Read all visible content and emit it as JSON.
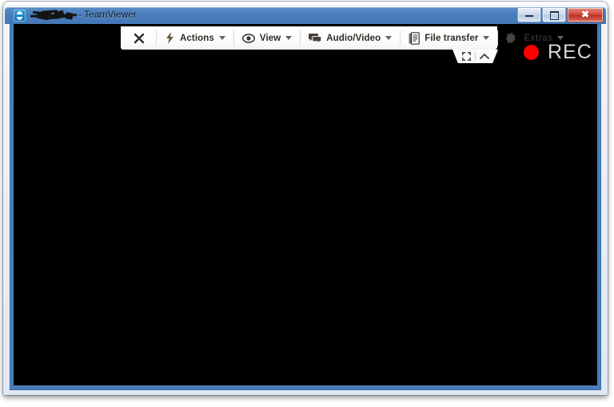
{
  "window": {
    "title_suffix": "- TeamViewer",
    "app_icon": "teamviewer-icon",
    "redacted_id_note": "partner-id-scribbled-out",
    "controls": {
      "minimize": "minimize-button",
      "maximize": "maximize-button",
      "close_glyph": "✖"
    }
  },
  "toolbar": {
    "close_glyph": "✖",
    "items": [
      {
        "label": "Actions",
        "icon": "lightning-bolt-icon",
        "caret": true
      },
      {
        "label": "View",
        "icon": "eye-icon",
        "caret": true
      },
      {
        "label": "Audio/Video",
        "icon": "speech-bubbles-icon",
        "caret": true
      },
      {
        "label": "File transfer",
        "icon": "document-transfer-icon",
        "caret": true
      },
      {
        "label": "Extras",
        "icon": "puzzle-piece-icon",
        "caret": true
      }
    ],
    "tab": {
      "fullscreen_icon": "fullscreen-corners-icon",
      "collapse_icon": "chevron-up-icon"
    }
  },
  "recording": {
    "label": "REC",
    "dot_color": "#ff0000",
    "text_color": "#d6d6d6"
  },
  "remote_screen": {
    "background": "#000000"
  },
  "colors": {
    "titlebar_blue": "#4a7ebb",
    "bezel_blue": "#4a7ebb",
    "frame_light": "#e8eef6",
    "toolbar_white": "#ffffff",
    "toolbar_text": "#312a24"
  }
}
